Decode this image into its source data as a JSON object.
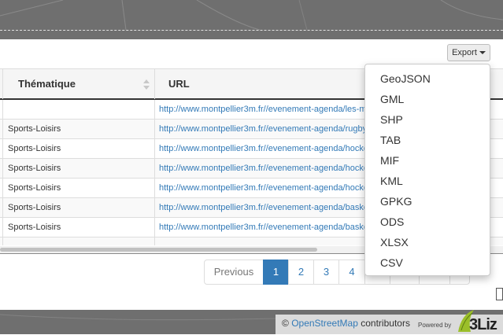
{
  "export": {
    "label": "Export"
  },
  "table": {
    "headers": {
      "thematique": "Thématique",
      "url": "URL"
    },
    "rows": [
      {
        "thematique": "",
        "url": "http://www.montpellier3m.fr//evenement-agenda/les-m"
      },
      {
        "thematique": "Sports-Loisirs",
        "url": "http://www.montpellier3m.fr//evenement-agenda/rugby"
      },
      {
        "thematique": "Sports-Loisirs",
        "url": "http://www.montpellier3m.fr//evenement-agenda/hocke"
      },
      {
        "thematique": "Sports-Loisirs",
        "url": "http://www.montpellier3m.fr//evenement-agenda/hocke"
      },
      {
        "thematique": "Sports-Loisirs",
        "url": "http://www.montpellier3m.fr//evenement-agenda/hocke"
      },
      {
        "thematique": "Sports-Loisirs",
        "url": "http://www.montpellier3m.fr//evenement-agenda/baske"
      },
      {
        "thematique": "Sports-Loisirs",
        "url": "http://www.montpellier3m.fr//evenement-agenda/baske"
      }
    ]
  },
  "pagination": {
    "previous": "Previous",
    "pages": [
      "1",
      "2",
      "3",
      "4"
    ],
    "active": "1"
  },
  "export_menu": {
    "items": [
      "GeoJSON",
      "GML",
      "SHP",
      "TAB",
      "MIF",
      "KML",
      "GPKG",
      "ODS",
      "XLSX",
      "CSV"
    ]
  },
  "attribution": {
    "copyright": "©",
    "osm": "OpenStreetMap",
    "contributors": "contributors",
    "powered_by": "Powered by",
    "logo": "3Liz"
  },
  "colors": {
    "link": "#337ab7",
    "active_page": "#337ab7",
    "map": "#6f6f6f"
  }
}
